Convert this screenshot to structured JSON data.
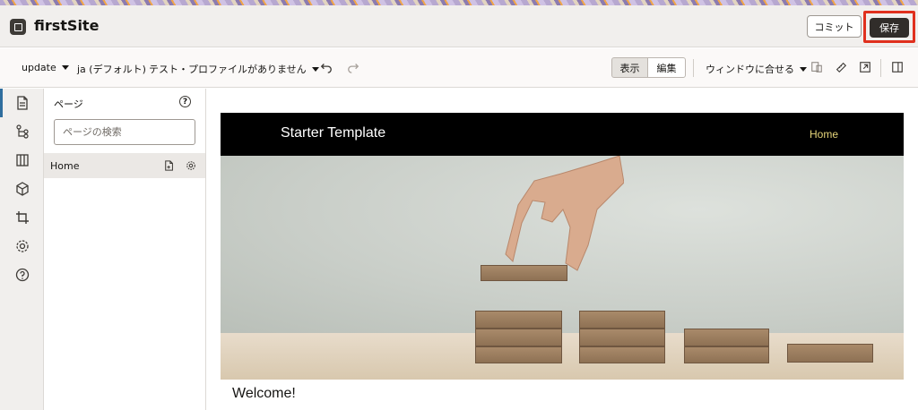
{
  "header": {
    "site_title": "firstSite",
    "commit_label": "コミット",
    "save_label": "保存"
  },
  "toolbar": {
    "branch": "update",
    "language": "ja (デフォルト)",
    "profile": "テスト・プロファイルがありません",
    "view_label": "表示",
    "edit_label": "編集",
    "zoom": "ウィンドウに合せる"
  },
  "rail": {
    "items": [
      "pages-icon",
      "structure-icon",
      "components-icon",
      "assets-icon",
      "crop-icon",
      "settings-icon",
      "help-icon"
    ]
  },
  "panel": {
    "title": "ページ",
    "search_placeholder": "ページの検索",
    "pages": [
      "Home"
    ]
  },
  "preview": {
    "brand": "Starter Template",
    "nav_home": "Home",
    "welcome": "Welcome!"
  },
  "colors": {
    "save_highlight": "#e0301e",
    "active_indicator": "#2f6e9e",
    "nav_link": "#e6d57a"
  }
}
